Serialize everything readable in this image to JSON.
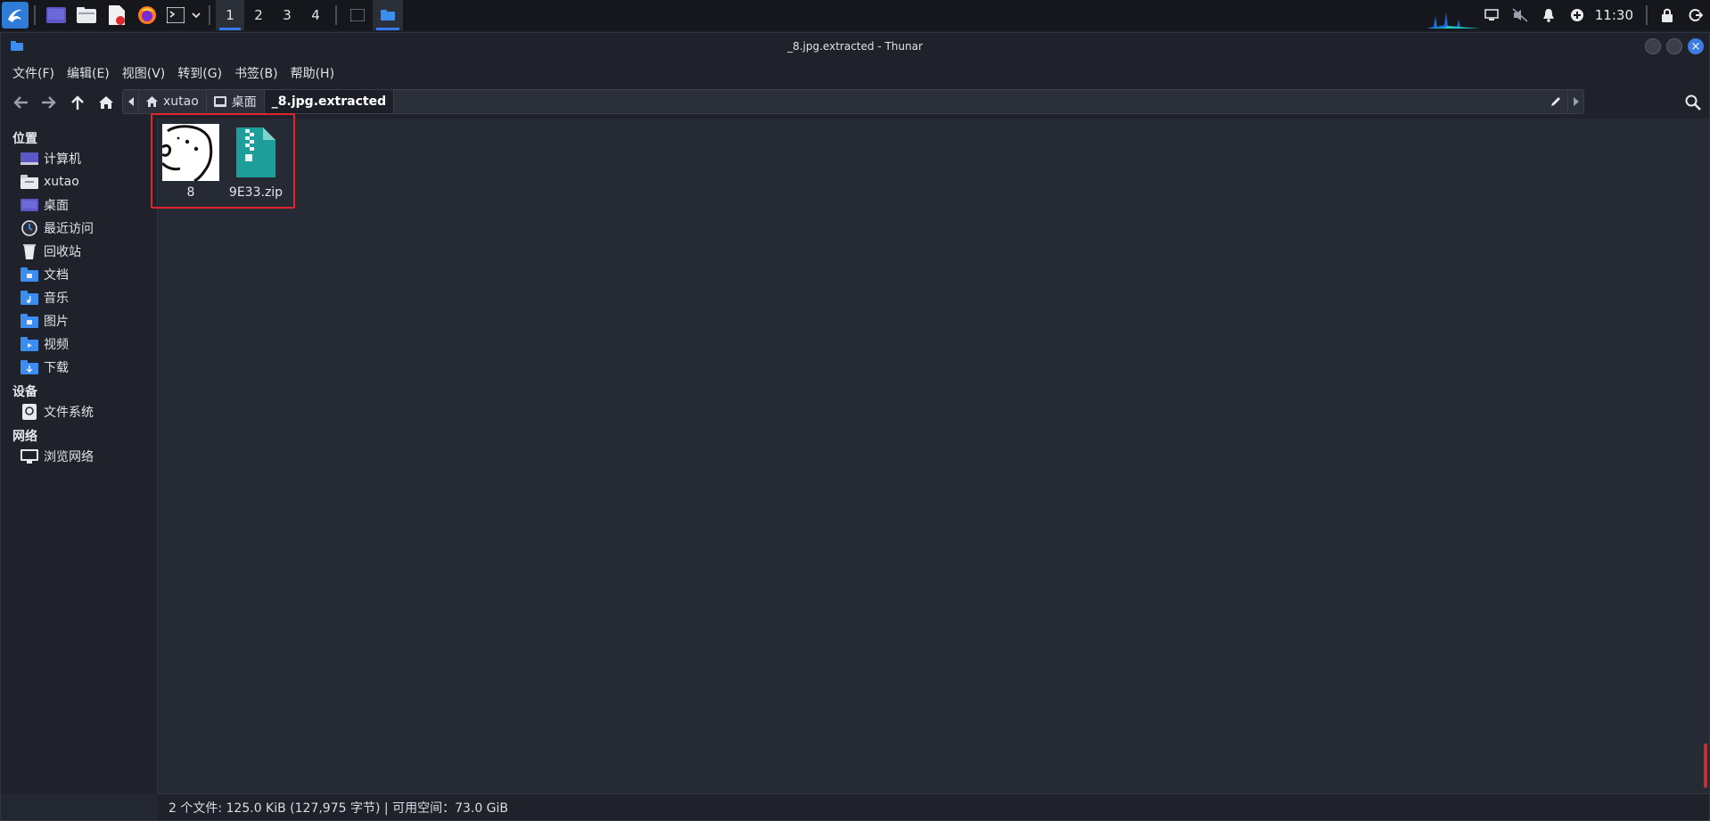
{
  "taskbar": {
    "workspaces": [
      "1",
      "2",
      "3",
      "4"
    ],
    "active_workspace": "1",
    "clock": "11:30"
  },
  "window": {
    "title": "_8.jpg.extracted - Thunar"
  },
  "menu": {
    "file": "文件(F)",
    "edit": "编辑(E)",
    "view": "视图(V)",
    "go": "转到(G)",
    "bookmarks": "书签(B)",
    "help": "帮助(H)"
  },
  "path": {
    "crumbs": [
      "xutao",
      "桌面",
      "_8.jpg.extracted"
    ]
  },
  "sidebar": {
    "places_heading": "位置",
    "places": [
      "计算机",
      "xutao",
      "桌面",
      "最近访问",
      "回收站",
      "文档",
      "音乐",
      "图片",
      "视频",
      "下载"
    ],
    "devices_heading": "设备",
    "devices": [
      "文件系统"
    ],
    "network_heading": "网络",
    "network": [
      "浏览网络"
    ]
  },
  "files": [
    {
      "name": "8",
      "icon": "image-thumbnail"
    },
    {
      "name": "9E33.zip",
      "icon": "zip-archive-icon"
    }
  ],
  "status": {
    "text": "2 个文件: 125.0 KiB (127,975 字节) | 可用空间：73.0 GiB"
  },
  "colors": {
    "accent": "#367bf0",
    "highlight": "#e0262b",
    "zip": "#1e9e9a"
  }
}
